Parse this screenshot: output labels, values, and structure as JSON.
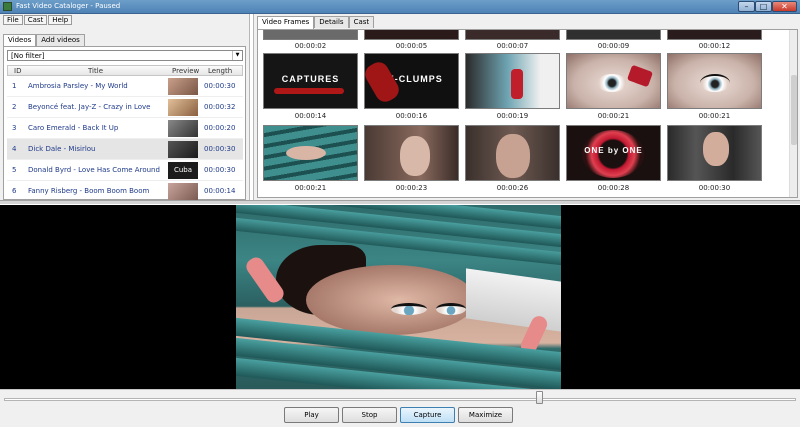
{
  "window": {
    "title": "Fast Video Cataloger - Paused",
    "controls": {
      "minimize": "–",
      "maximize": "□",
      "close": "✕"
    }
  },
  "menu": [
    "File",
    "Cast",
    "Help"
  ],
  "left_tabs": [
    "Videos",
    "Add videos"
  ],
  "filter": {
    "value": "[No filter]"
  },
  "table": {
    "headers": {
      "id": "ID",
      "title": "Title",
      "preview": "Preview",
      "length": "Length"
    },
    "rows": [
      {
        "id": "1",
        "title": "Ambrosia Parsley - My World",
        "length": "00:00:30",
        "thumb_color": "#b08870"
      },
      {
        "id": "2",
        "title": "Beyoncé feat. Jay-Z - Crazy in Love",
        "length": "00:00:32",
        "thumb_color": "#c9a07a"
      },
      {
        "id": "3",
        "title": "Caro Emerald - Back It Up",
        "length": "00:00:20",
        "thumb_color": "#5a5a5a"
      },
      {
        "id": "4",
        "title": "Dick Dale - Misirlou",
        "length": "00:00:30",
        "thumb_color": "#3c3c3c"
      },
      {
        "id": "5",
        "title": "Donald Byrd - Love Has Come Around",
        "length": "00:00:30",
        "thumb_color": "#222222",
        "thumb_text": "Cuba"
      },
      {
        "id": "6",
        "title": "Fanny Risberg - Boom Boom Boom",
        "length": "00:00:14",
        "thumb_color": "#b08a80"
      }
    ]
  },
  "right_tabs": [
    "Video Frames",
    "Details",
    "Cast"
  ],
  "frames": {
    "row0_labels": [
      "00:00:02",
      "00:00:05",
      "00:00:07",
      "00:00:09",
      "00:00:12"
    ],
    "row1": [
      {
        "time": "00:00:14",
        "caption": "CAPTURES",
        "color": "#1a1a1a"
      },
      {
        "time": "00:00:16",
        "caption": "DE-CLUMPS",
        "color": "#141414"
      },
      {
        "time": "00:00:19",
        "caption": "",
        "color": "#7aa6b0"
      },
      {
        "time": "00:00:21",
        "caption": "",
        "color": "#c9b6b0"
      },
      {
        "time": "00:00:21",
        "caption": "",
        "color": "#c2b0aa"
      }
    ],
    "row2": [
      {
        "time": "00:00:21",
        "caption": "",
        "color": "#3a7e7e"
      },
      {
        "time": "00:00:23",
        "caption": "",
        "color": "#6a5048"
      },
      {
        "time": "00:00:26",
        "caption": "",
        "color": "#5a4640"
      },
      {
        "time": "00:00:28",
        "caption": "ONE by ONE",
        "color": "#8a1a1a"
      },
      {
        "time": "00:00:30",
        "caption": "",
        "color": "#404040"
      }
    ]
  },
  "buttons": {
    "play": "Play",
    "stop": "Stop",
    "capture": "Capture",
    "maximize": "Maximize"
  },
  "seek": {
    "position_fraction": 0.675
  }
}
